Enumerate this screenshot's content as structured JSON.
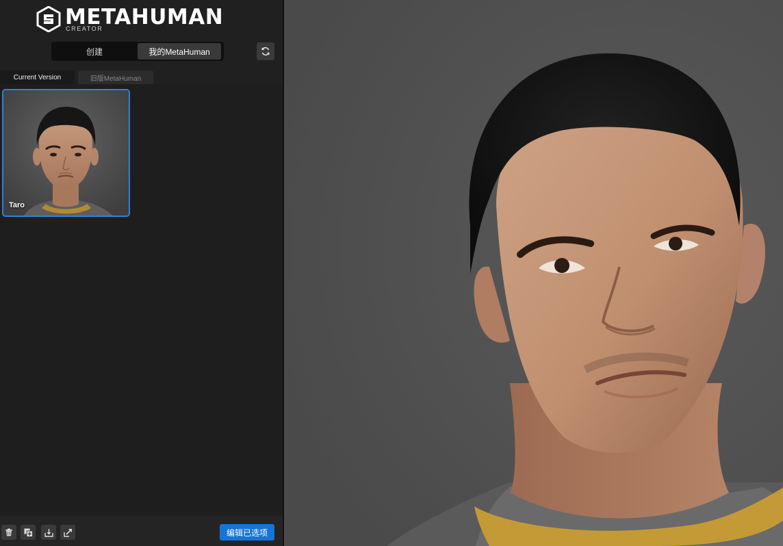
{
  "app": {
    "logo_title": "METAHUMAN",
    "logo_subtitle": "CREATOR"
  },
  "mode_toggle": {
    "create_label": "创建",
    "my_metahuman_label": "我的MetaHuman",
    "active": "我的MetaHuman"
  },
  "tabs": {
    "current_label": "Current Version",
    "legacy_label": "旧版MetaHuman"
  },
  "characters": [
    {
      "name": "Taro",
      "selected": true
    }
  ],
  "footer": {
    "delete_icon": "trash-icon",
    "duplicate_icon": "duplicate-icon",
    "download_icon": "download-icon",
    "export_icon": "export-icon",
    "edit_selected_label": "编辑已选项"
  },
  "colors": {
    "accent": "#1474d8",
    "selection_border": "#2f7fe0",
    "panel_bg": "#1e1e1e",
    "viewport_bg": "#555555"
  }
}
